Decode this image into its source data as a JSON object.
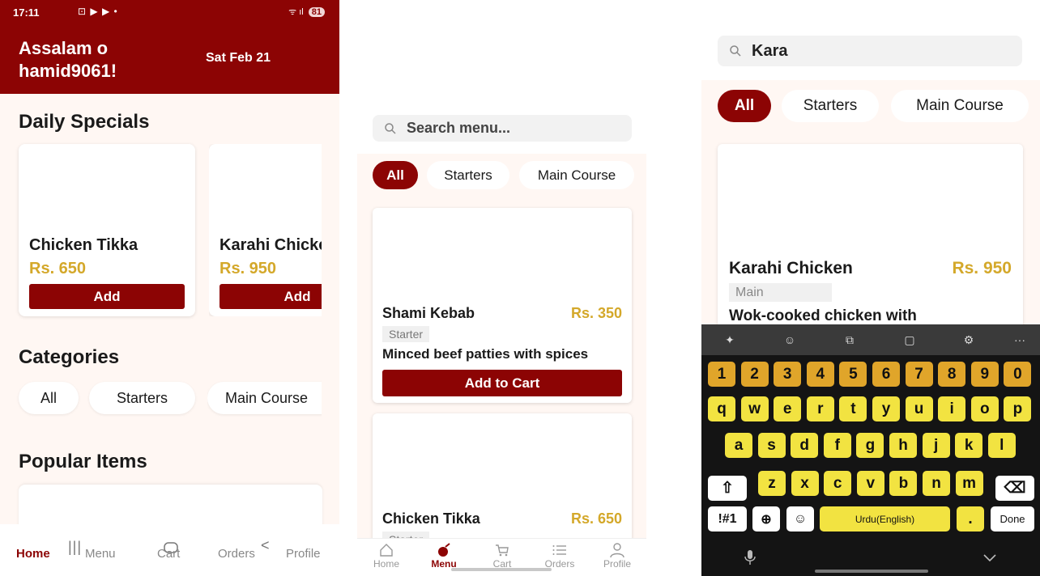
{
  "screen1": {
    "status": {
      "time": "17:11",
      "icons": "⊡ ▶ ▶ •",
      "signal": "ᯤ ıl",
      "battery": "81"
    },
    "header": {
      "greeting": "Assalam o hamid9061!",
      "date": "Sat Feb 21"
    },
    "daily_specials": {
      "title": "Daily Specials",
      "items": [
        {
          "name": "Chicken Tikka",
          "price": "Rs. 650",
          "button": "Add"
        },
        {
          "name": "Karahi Chicken",
          "price": "Rs. 950",
          "button": "Add"
        }
      ]
    },
    "categories": {
      "title": "Categories",
      "items": [
        "All",
        "Starters",
        "Main Course"
      ]
    },
    "popular": {
      "title": "Popular Items"
    },
    "nav": {
      "home": "Home",
      "menu": "Menu",
      "cart": "Cart",
      "orders": "Orders",
      "profile": "Profile"
    }
  },
  "screen2": {
    "search": {
      "placeholder": "Search menu..."
    },
    "filters": [
      "All",
      "Starters",
      "Main Course"
    ],
    "items": [
      {
        "name": "Shami Kebab",
        "price": "Rs. 350",
        "tag": "Starter",
        "description": "Minced beef patties with spices",
        "button": "Add to Cart"
      },
      {
        "name": "Chicken Tikka",
        "price": "Rs. 650",
        "tag": "Starter"
      }
    ],
    "nav": {
      "home": "Home",
      "menu": "Menu",
      "cart": "Cart",
      "orders": "Orders",
      "profile": "Profile"
    }
  },
  "screen3": {
    "search": {
      "value": "Kara"
    },
    "filters": [
      "All",
      "Starters",
      "Main Course"
    ],
    "result": {
      "name": "Karahi Chicken",
      "price": "Rs. 950",
      "tag": "Main",
      "description": "Wok-cooked chicken with"
    },
    "keyboard": {
      "toolbar_icons": [
        "sparkle-icon",
        "emoji-icon",
        "translate-icon",
        "clipboard-icon",
        "settings-icon",
        "more-icon"
      ],
      "row_numbers": [
        "1",
        "2",
        "3",
        "4",
        "5",
        "6",
        "7",
        "8",
        "9",
        "0"
      ],
      "row1": [
        "q",
        "w",
        "e",
        "r",
        "t",
        "y",
        "u",
        "i",
        "o",
        "p"
      ],
      "row2": [
        "a",
        "s",
        "d",
        "f",
        "g",
        "h",
        "j",
        "k",
        "l"
      ],
      "row3": [
        "z",
        "x",
        "c",
        "v",
        "b",
        "n",
        "m"
      ],
      "symbols": "!#1",
      "language": "Urdu(English)",
      "period": ".",
      "done": "Done",
      "more": "···"
    }
  },
  "colors": {
    "brand": "#8c0404",
    "price": "#d4a82a",
    "background": "#fff7f3",
    "key_number": "#e0a52a",
    "key_letter": "#f2e341"
  }
}
